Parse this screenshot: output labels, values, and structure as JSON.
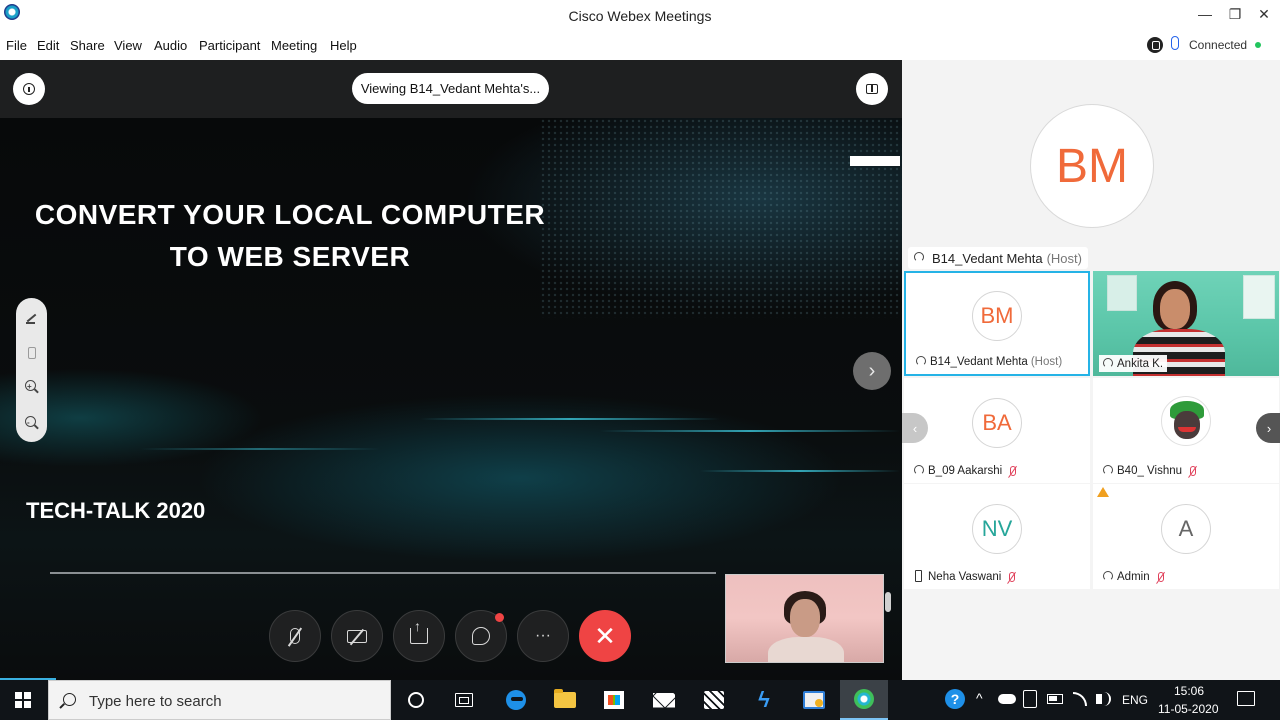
{
  "window": {
    "title": "Cisco Webex Meetings",
    "controls": {
      "minimize": "—",
      "restore": "❐",
      "close": "✕"
    }
  },
  "menu": {
    "items": [
      "File",
      "Edit",
      "Share",
      "View",
      "Audio",
      "Participant",
      "Meeting",
      "Help"
    ],
    "status": "Connected",
    "status_color": "#22c55e"
  },
  "stage": {
    "viewing_label": "Viewing B14_Vedant Mehta's...",
    "next_glyph": "›",
    "slide": {
      "title_line1": "CONVERT YOUR LOCAL COMPUTER",
      "title_line2": "TO WEB SERVER",
      "subtitle": "TECH-TALK 2020"
    },
    "controls": {
      "more_glyph": "···",
      "end_glyph": "✕"
    },
    "annotation_tools": [
      "pen-icon",
      "eraser-icon",
      "zoom-in-icon",
      "zoom-out-icon"
    ]
  },
  "panel": {
    "active_speaker": {
      "initials": "BM",
      "name": "B14_Vedant Mehta",
      "role": "(Host)",
      "avatar_color": "#f06a3a"
    },
    "tiles": [
      {
        "initials": "BM",
        "name": "B14_Vedant Mehta",
        "role": "(Host)",
        "color": "#f06a3a",
        "muted": false,
        "selected": true,
        "icon": "headset-icon"
      },
      {
        "initials": "",
        "name": "Ankita K.",
        "role": "",
        "color": "",
        "muted": false,
        "selected": false,
        "icon": "headset-icon",
        "video": true
      },
      {
        "initials": "BA",
        "name": "B_09 Aakarshi",
        "role": "",
        "color": "#f06a3a",
        "muted": true,
        "selected": false,
        "icon": "headset-icon"
      },
      {
        "initials": "",
        "name": "B40_ Vishnu",
        "role": "",
        "color": "",
        "muted": true,
        "selected": false,
        "icon": "headset-icon",
        "avatar_image": "joker-avatar"
      },
      {
        "initials": "NV",
        "name": "Neha Vaswani",
        "role": "",
        "color": "#26a69a",
        "muted": true,
        "selected": false,
        "icon": "phone-icon"
      },
      {
        "initials": "A",
        "name": "Admin",
        "role": "",
        "color": "#666666",
        "muted": true,
        "selected": false,
        "icon": "headset-icon",
        "warning": true
      }
    ]
  },
  "taskbar": {
    "search_placeholder": "Type here to search",
    "apps": [
      "cortana-icon",
      "task-view-icon",
      "edge-icon",
      "file-explorer-icon",
      "store-icon",
      "mail-icon",
      "dropbox-icon",
      "bolt-icon",
      "paint-icon",
      "webex-icon"
    ],
    "tray": {
      "language": "ENG",
      "time": "15:06",
      "date": "11-05-2020",
      "help_glyph": "?",
      "chevron": "^"
    }
  }
}
